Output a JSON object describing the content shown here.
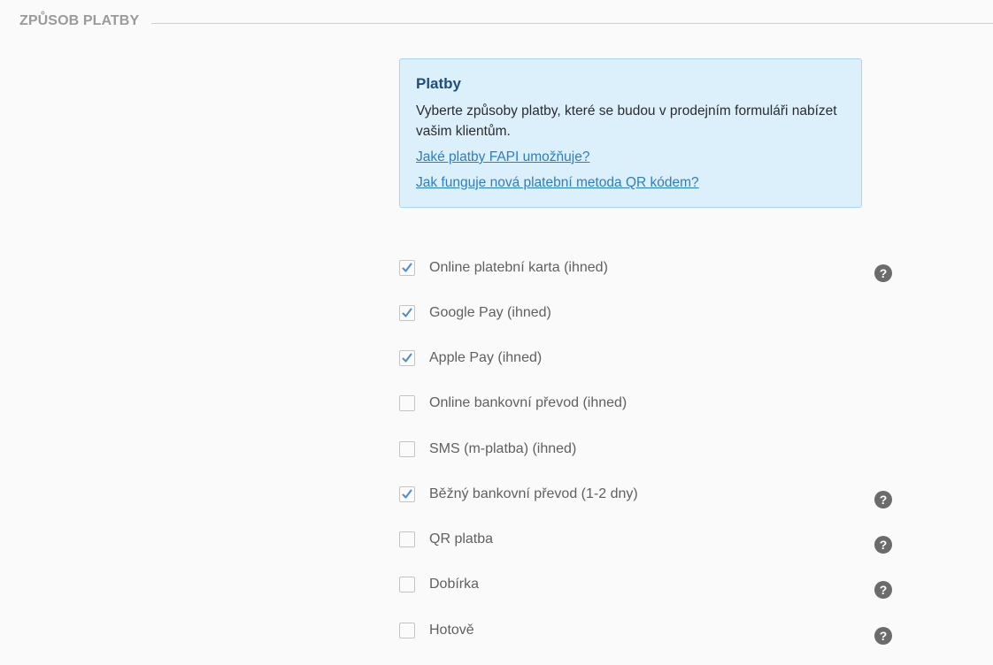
{
  "section": {
    "title": "ZPŮSOB PLATBY"
  },
  "info": {
    "title": "Platby",
    "text": "Vyberte způsoby platby, které se budou v prodejním formuláři nabízet vašim klientům.",
    "link1": "Jaké platby FAPI umožňuje?",
    "link2": "Jak funguje nová platební metoda QR kódem?"
  },
  "methods": [
    {
      "label": "Online platební karta (ihned)",
      "checked": true,
      "help": true
    },
    {
      "label": "Google Pay (ihned)",
      "checked": true,
      "help": false
    },
    {
      "label": "Apple Pay (ihned)",
      "checked": true,
      "help": false
    },
    {
      "label": "Online bankovní převod (ihned)",
      "checked": false,
      "help": false
    },
    {
      "label": "SMS (m-platba) (ihned)",
      "checked": false,
      "help": false
    },
    {
      "label": "Běžný bankovní převod (1-2 dny)",
      "checked": true,
      "help": true
    },
    {
      "label": "QR platba",
      "checked": false,
      "help": true
    },
    {
      "label": "Dobírka",
      "checked": false,
      "help": true
    },
    {
      "label": "Hotově",
      "checked": false,
      "help": true
    }
  ],
  "help_glyph": "?",
  "colors": {
    "info_bg": "#dcf0fc",
    "info_border": "#a9d4ef",
    "info_title": "#1f4e79",
    "link": "#2b7fc0",
    "checkmark": "#4a90c8",
    "help_icon": "#6b6b6b"
  }
}
